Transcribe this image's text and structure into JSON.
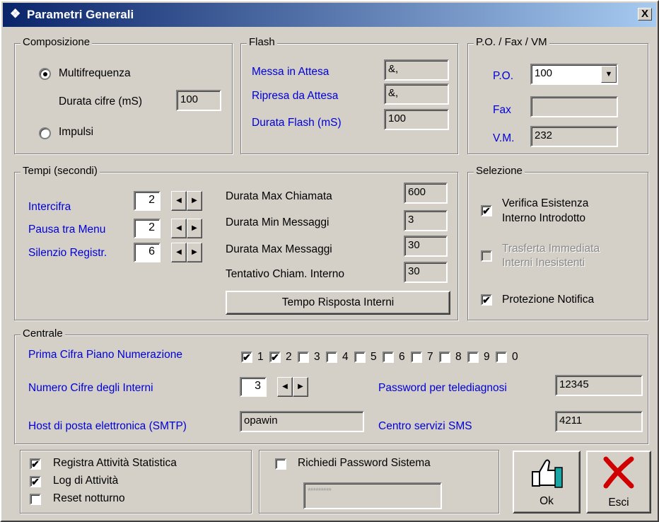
{
  "window": {
    "title": "Parametri Generali",
    "close_glyph": "X"
  },
  "composizione": {
    "title": "Composizione",
    "multifrequenza": "Multifrequenza",
    "durata_cifre_label": "Durata cifre (mS)",
    "durata_cifre_value": "100",
    "impulsi": "Impulsi",
    "selected": "Multifrequenza"
  },
  "flash": {
    "title": "Flash",
    "messa_label": "Messa in Attesa",
    "messa_value": "&,",
    "ripresa_label": "Ripresa da Attesa",
    "ripresa_value": "&,",
    "durata_label": "Durata Flash (mS)",
    "durata_value": "100"
  },
  "po": {
    "title": "P.O. / Fax / VM",
    "po_label": "P.O.",
    "po_value": "100",
    "fax_label": "Fax",
    "fax_value": "",
    "vm_label": "V.M.",
    "vm_value": "232"
  },
  "tempi": {
    "title": "Tempi (secondi)",
    "intercifra_label": "Intercifra",
    "intercifra_value": "2",
    "pausa_label": "Pausa tra Menu",
    "pausa_value": "2",
    "silenzio_label": "Silenzio Registr.",
    "silenzio_value": "6",
    "max_chiamata_label": "Durata Max Chiamata",
    "max_chiamata_value": "600",
    "min_messaggi_label": "Durata Min Messaggi",
    "min_messaggi_value": "3",
    "max_messaggi_label": "Durata Max Messaggi",
    "max_messaggi_value": "30",
    "tentativo_label": "Tentativo Chiam. Interno",
    "tentativo_value": "30",
    "tempo_risposta_button": "Tempo Risposta Interni"
  },
  "selezione": {
    "title": "Selezione",
    "verifica_line1": "Verifica Esistenza",
    "verifica_line2": "Interno Introdotto",
    "verifica_checked": true,
    "trasferta_line1": "Trasferta Immediata",
    "trasferta_line2": "Interni Inesistenti",
    "trasferta_checked": false,
    "protezione_label": "Protezione Notifica",
    "protezione_checked": true
  },
  "centrale": {
    "title": "Centrale",
    "prima_cifra_label": "Prima Cifra Piano Numerazione",
    "digits": [
      "1",
      "2",
      "3",
      "4",
      "5",
      "6",
      "7",
      "8",
      "9",
      "0"
    ],
    "digits_checked": [
      true,
      true,
      false,
      false,
      false,
      false,
      false,
      false,
      false,
      false
    ],
    "numero_cifre_label": "Numero Cifre degli Interni",
    "numero_cifre_value": "3",
    "password_label": "Password per telediagnosi",
    "password_value": "12345",
    "smtp_label": "Host di posta elettronica (SMTP)",
    "smtp_value": "opawin",
    "sms_label": "Centro servizi SMS",
    "sms_value": "4211"
  },
  "options": {
    "registra_label": "Registra Attività Statistica",
    "registra_checked": true,
    "log_label": "Log di Attività",
    "log_checked": true,
    "reset_label": "Reset notturno",
    "reset_checked": false
  },
  "password_sistema": {
    "label": "Richiedi Password Sistema",
    "checked": false,
    "masked_value": "*********"
  },
  "buttons": {
    "ok": "Ok",
    "esci": "Esci"
  },
  "glyphs": {
    "check": "✔",
    "left": "◀",
    "right": "▶",
    "down": "▼"
  },
  "colors": {
    "label_blue": "#0000d8",
    "face": "#d4d0c8",
    "title_start": "#0a246a",
    "title_end": "#a6caf0"
  }
}
